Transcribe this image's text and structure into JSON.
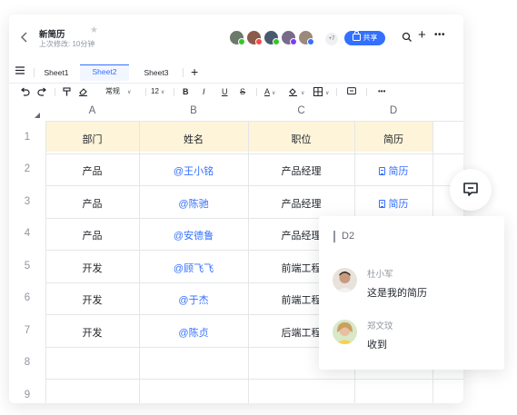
{
  "header": {
    "title": "新简历",
    "subtitle": "上次修改: 10分钟",
    "avatar_count": "+7",
    "share_label": "共享"
  },
  "sheet_tabs": [
    {
      "label": "Sheet1",
      "active": false
    },
    {
      "label": "Sheet2",
      "active": true
    },
    {
      "label": "Sheet3",
      "active": false
    }
  ],
  "toolbar": {
    "format_label": "常规",
    "font_size": "12",
    "bold": "B",
    "italic": "I",
    "underline": "U",
    "strike": "S",
    "text_color": "A"
  },
  "grid": {
    "columns": [
      "A",
      "B",
      "C",
      "D"
    ],
    "row_numbers": [
      "1",
      "2",
      "3",
      "4",
      "5",
      "6",
      "7",
      "8",
      "9"
    ],
    "rows": [
      [
        "部门",
        "姓名",
        "职位",
        "简历"
      ],
      [
        "产品",
        "@王小铭",
        "产品经理",
        "简历"
      ],
      [
        "产品",
        "@陈驰",
        "产品经理",
        "简历"
      ],
      [
        "产品",
        "@安德鲁",
        "产品经理",
        ""
      ],
      [
        "开发",
        "@顾飞飞",
        "前端工程",
        ""
      ],
      [
        "开发",
        "@于杰",
        "前端工程",
        ""
      ],
      [
        "开发",
        "@陈贞",
        "后端工程",
        ""
      ]
    ]
  },
  "comment_panel": {
    "cell_ref": "D2",
    "comments": [
      {
        "author": "杜小军",
        "text": "这是我的简历"
      },
      {
        "author": "郑文玟",
        "text": "收到"
      }
    ]
  },
  "colors": {
    "accent": "#3370ff",
    "header_row_bg": "#fdf4d9"
  }
}
